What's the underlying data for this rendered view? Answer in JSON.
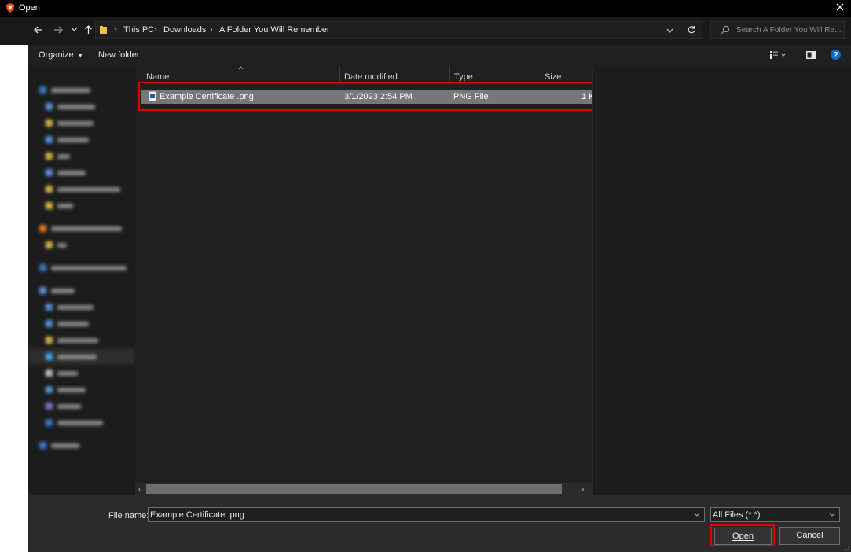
{
  "window": {
    "title": "Open"
  },
  "breadcrumb": [
    "This PC",
    "Downloads",
    "A Folder You Will Remember"
  ],
  "search": {
    "placeholder": "Search A Folder You Will Re..."
  },
  "toolbar": {
    "organize": "Organize",
    "new_folder": "New folder"
  },
  "columns": {
    "name": "Name",
    "date": "Date modified",
    "type": "Type",
    "size": "Size"
  },
  "files": [
    {
      "name": "Example Certificate .png",
      "date": "3/1/2023 2:54 PM",
      "type": "PNG File",
      "size": "1 K"
    }
  ],
  "footer": {
    "file_name_label": "File name:",
    "file_name_value": "Example Certificate .png",
    "file_type": "All Files (*.*)",
    "open_label": "Open",
    "cancel_label": "Cancel"
  },
  "colors": {
    "highlight": "#e00000",
    "accent_app": "#f3512b",
    "help": "#0f6cd1"
  }
}
